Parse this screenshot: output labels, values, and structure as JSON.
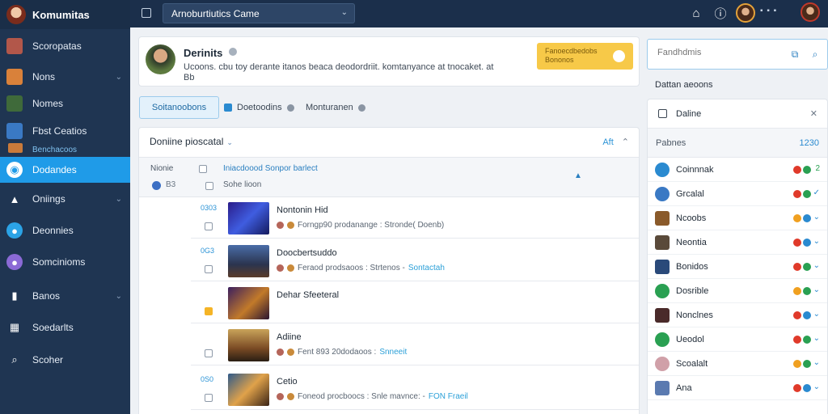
{
  "app": {
    "title": "Komumitas"
  },
  "sidebar": {
    "items": [
      {
        "label": "Scoropatas"
      },
      {
        "label": "Nons"
      },
      {
        "label": "Nomes"
      },
      {
        "label": "Fbst Ceatios"
      },
      {
        "label": "Dodandes"
      },
      {
        "label": "Oniings"
      },
      {
        "label": "Deonnies"
      },
      {
        "label": "Somcinioms"
      },
      {
        "label": "Banos"
      },
      {
        "label": "Soedarlts"
      },
      {
        "label": "Scoher"
      }
    ],
    "sub_label": "Benchacoos"
  },
  "topbar": {
    "selected_game": "Arnoburtiutics Came"
  },
  "profile": {
    "name": "Derinits",
    "description": "Ucoons. cbu toy derante itanos beaca deodordriit. komtanyance at tnocaket. at Bb",
    "promo_line1": "Fanoecdbedobs",
    "promo_line2": "Bononos"
  },
  "tabs": [
    {
      "label": "Soitanoobons"
    },
    {
      "label": "Doetoodins"
    },
    {
      "label": "Monturanen"
    }
  ],
  "list": {
    "header_label": "Doniine pioscatal",
    "header_right": "Aft",
    "col_name": "Nionie",
    "col_num": "B3",
    "col_link": "Iniacdoood Sonpor barlect",
    "col_sub": "Sohe lioon",
    "rows": [
      {
        "num": "0303",
        "title": "Nontonin Hid",
        "meta": "Forngp90 prodanange : Stronde( Doenb)",
        "link": ""
      },
      {
        "num": "0G3",
        "title": "Doocbertsuddo",
        "meta": "Feraod prodsaoos : Strtenos -",
        "link": "Sontactah"
      },
      {
        "num": "",
        "title": "Dehar Sfeeteral",
        "meta": "",
        "link": ""
      },
      {
        "num": "",
        "title": "Adiine",
        "meta": "Fent 893 20dodaoos :",
        "link": "Snneeit"
      },
      {
        "num": "0S0",
        "title": "Cetio",
        "meta": "Foneod procboocs : Snle mavnce: -",
        "link": "FON Fraeil"
      }
    ]
  },
  "right_panel": {
    "search_placeholder": "Fandhdmis",
    "title": "Dattan aeoons",
    "online_label": "Daline",
    "friends_header": "Pabnes",
    "friends_count": "1230",
    "friends": [
      {
        "name": "Coinnnak"
      },
      {
        "name": "Grcalal"
      },
      {
        "name": "Ncoobs"
      },
      {
        "name": "Neontia"
      },
      {
        "name": "Bonidos"
      },
      {
        "name": "Dosrible"
      },
      {
        "name": "Nonclnes"
      },
      {
        "name": "Ueodol"
      },
      {
        "name": "Scoalalt"
      },
      {
        "name": "Ana"
      }
    ]
  },
  "colors": {
    "sidebar_bg": "#1f3552",
    "active_nav": "#1f9be8",
    "accent": "#2a8ad0",
    "promo": "#f7c948"
  }
}
